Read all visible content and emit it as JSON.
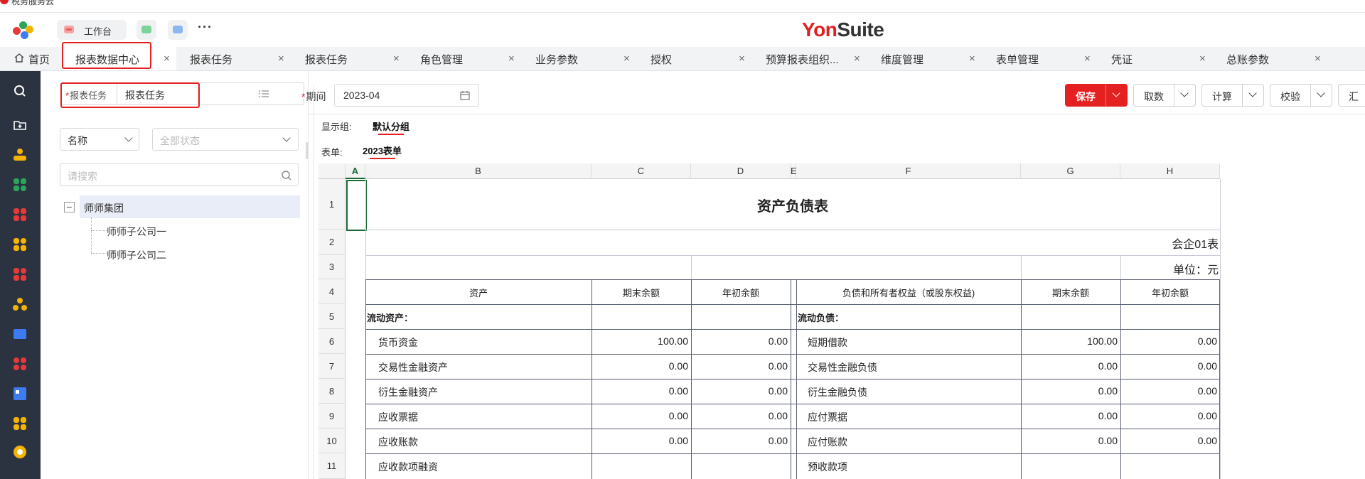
{
  "browser_tab": {
    "title": "税务服务云"
  },
  "header": {
    "pinned": [
      {
        "label": "工作台"
      }
    ],
    "more": "···",
    "brand": {
      "part1": "Yon",
      "part2": "Suite"
    }
  },
  "tabs": [
    {
      "label": "首页",
      "icon": "home-icon"
    },
    {
      "label": "报表数据中心",
      "active": true
    },
    {
      "label": "报表任务"
    },
    {
      "label": "报表任务"
    },
    {
      "label": "角色管理"
    },
    {
      "label": "业务参数"
    },
    {
      "label": "授权"
    },
    {
      "label": "预算报表组织..."
    },
    {
      "label": "维度管理"
    },
    {
      "label": "表单管理"
    },
    {
      "label": "凭证"
    },
    {
      "label": "总账参数"
    }
  ],
  "tab_close": "×",
  "sidebar_icons": [
    "search-icon",
    "folder-add-icon",
    "user-icon",
    "apps-green-icon",
    "apps-red-icon",
    "apps-yellow-icon",
    "apps-red2-icon",
    "users-icon",
    "list-icon",
    "apps-red3-icon",
    "report-icon",
    "apps-yellow2-icon",
    "coin-icon"
  ],
  "left_panel": {
    "task_label": "报表任务",
    "task_value": "报表任务",
    "filter_name": "名称",
    "filter_status_placeholder": "全部状态",
    "search_placeholder": "请搜索",
    "tree": {
      "root": "师师集团",
      "children": [
        "师师子公司一",
        "师师子公司二"
      ]
    },
    "tree_toggle": "−"
  },
  "toolbar": {
    "period_label": "期间",
    "period_value": "2023-04",
    "save": "保存",
    "fetch": "取数",
    "calc": "计算",
    "verify": "校验",
    "summary": "汇"
  },
  "display_group": {
    "label": "显示组:",
    "value": "默认分组"
  },
  "form": {
    "label": "表单:",
    "value": "2023表单"
  },
  "sheet": {
    "columns": [
      "A",
      "B",
      "C",
      "D",
      "E",
      "F",
      "G",
      "H"
    ],
    "rows": [
      "1",
      "2",
      "3",
      "4",
      "5",
      "6",
      "7",
      "8",
      "9",
      "10",
      "11"
    ],
    "title": "资产负债表",
    "form_code": "会企01表",
    "unit": "单位：元",
    "headers": [
      "资产",
      "期末余额",
      "年初余额",
      "负债和所有者权益（或股东权益)",
      "期末余额",
      "年初余额"
    ],
    "left_section": "流动资产：",
    "right_section": "流动负债：",
    "data_rows": [
      {
        "asset": "货币资金",
        "end": "100.00",
        "begin": "0.00",
        "liab": "短期借款",
        "lend": "100.00",
        "lbegin": "0.00"
      },
      {
        "asset": "交易性金融资产",
        "end": "0.00",
        "begin": "0.00",
        "liab": "交易性金融负债",
        "lend": "0.00",
        "lbegin": "0.00"
      },
      {
        "asset": "衍生金融资产",
        "end": "0.00",
        "begin": "0.00",
        "liab": "衍生金融负债",
        "lend": "0.00",
        "lbegin": "0.00"
      },
      {
        "asset": "应收票据",
        "end": "0.00",
        "begin": "0.00",
        "liab": "应付票据",
        "lend": "0.00",
        "lbegin": "0.00"
      },
      {
        "asset": "应收账款",
        "end": "0.00",
        "begin": "0.00",
        "liab": "应付账款",
        "lend": "0.00",
        "lbegin": "0.00"
      },
      {
        "asset": "应收款项融资",
        "end": "",
        "begin": "",
        "liab": "预收款项",
        "lend": "",
        "lbegin": ""
      }
    ]
  },
  "colors": {
    "accent": "#e02020",
    "nav_bg": "#2c3340",
    "highlight_box": "#e52020"
  }
}
